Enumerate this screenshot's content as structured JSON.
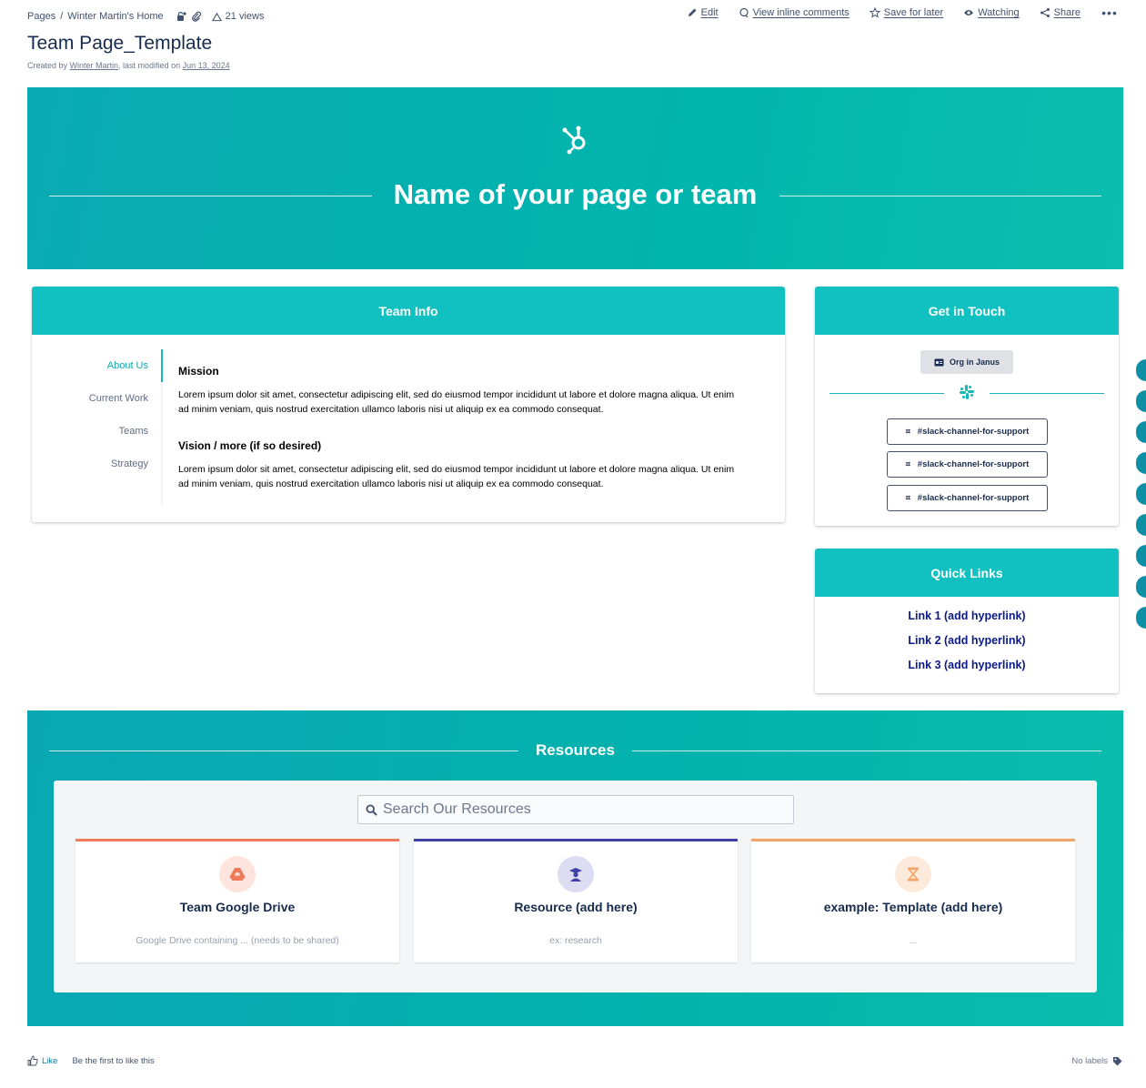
{
  "breadcrumb": {
    "root": "Pages",
    "separator": "/",
    "space": "Winter Martin's Home",
    "views": "21 views"
  },
  "actions": {
    "edit": "Edit",
    "comments": "View inline comments",
    "save": "Save for later",
    "watching": "Watching",
    "share": "Share",
    "more": "•••"
  },
  "page": {
    "title": "Team Page_Template",
    "created_prefix": "Created by ",
    "author": "Winter Martin",
    "modified_prefix": ", last modified on ",
    "modified_date": "Jun 13, 2024"
  },
  "hero": {
    "title": "Name of your page or team"
  },
  "team_info": {
    "header": "Team Info",
    "nav": [
      "About Us",
      "Current Work",
      "Teams",
      "Strategy"
    ],
    "active_index": 0,
    "sections": [
      {
        "heading": "Mission",
        "body": "Lorem ipsum dolor sit amet, consectetur adipiscing elit, sed do eiusmod tempor incididunt ut labore et dolore magna aliqua. Ut enim ad minim veniam, quis nostrud exercitation ullamco laboris nisi ut aliquip ex ea commodo consequat."
      },
      {
        "heading": "Vision / more (if so desired)",
        "body": "Lorem ipsum dolor sit amet, consectetur adipiscing elit, sed do eiusmod tempor incididunt ut labore et dolore magna aliqua. Ut enim ad minim veniam, quis nostrud exercitation ullamco laboris nisi ut aliquip ex ea commodo consequat."
      }
    ]
  },
  "get_in_touch": {
    "header": "Get in Touch",
    "org_button": "Org in Janus",
    "slack_channels": [
      "#slack-channel-for-support",
      "#slack-channel-for-support",
      "#slack-channel-for-support"
    ]
  },
  "quick_links": {
    "header": "Quick Links",
    "links": [
      "Link 1 (add hyperlink)",
      "Link 2 (add hyperlink)",
      "Link 3 (add hyperlink)"
    ]
  },
  "resources": {
    "title": "Resources",
    "search_placeholder": "Search Our Resources",
    "cards": [
      {
        "title": "Team Google Drive",
        "desc": "Google Drive containing ... (needs to be shared)",
        "accent": "#f07b5a",
        "icon": "google-drive-icon"
      },
      {
        "title": "Resource (add here)",
        "desc": "ex: research",
        "accent": "#3f3fa8",
        "icon": "graduate-icon"
      },
      {
        "title": "example: Template (add here)",
        "desc": "...",
        "accent": "#f5a467",
        "icon": "hourglass-icon"
      }
    ]
  },
  "footer": {
    "like": "Like",
    "first_like": "Be the first to like this",
    "labels": "No labels"
  },
  "colors": {
    "teal": "#11c0c0",
    "hero": "#00b5ad",
    "link_navy": "#0b1a86"
  }
}
